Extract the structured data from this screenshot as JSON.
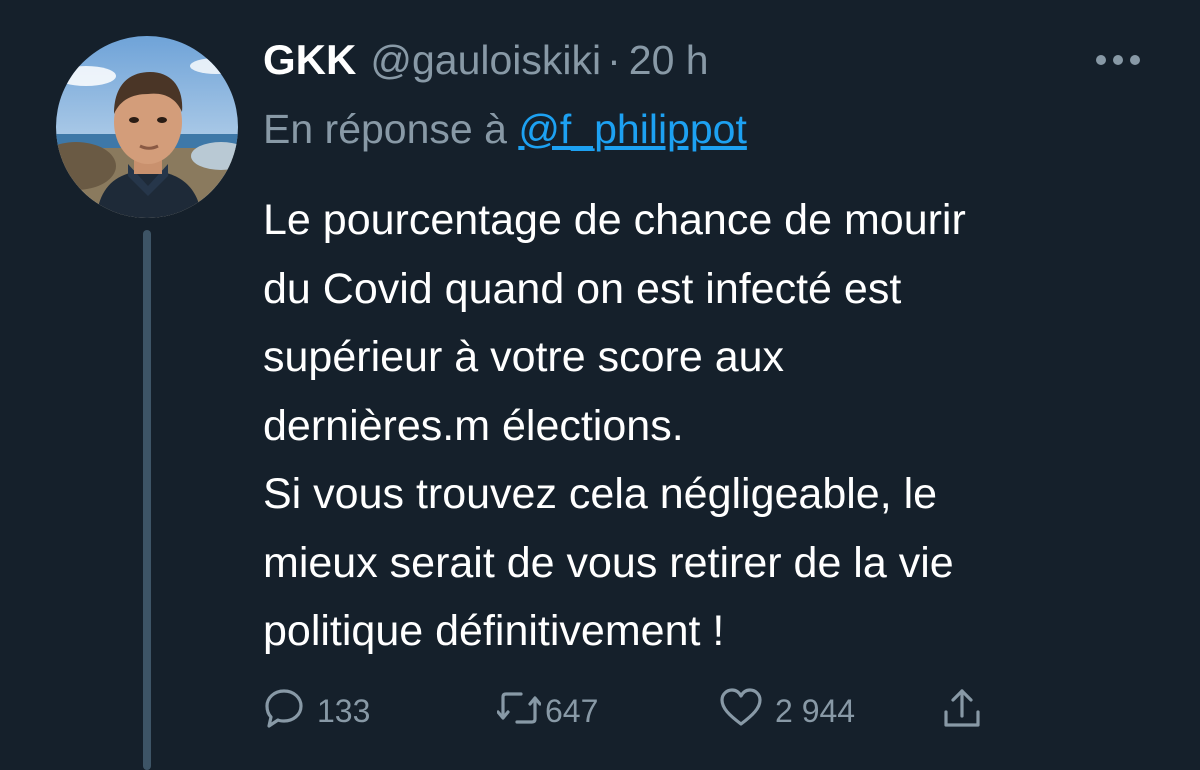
{
  "tweet": {
    "author": {
      "name": "GKK",
      "handle": "@gauloiskiki",
      "separator": "·",
      "time": "20 h"
    },
    "reply_to": {
      "prefix": "En réponse à",
      "mention": "@f_philippot"
    },
    "body_lines": [
      "Le pourcentage de chance de mourir",
      "du Covid quand on est infecté est",
      "supérieur à votre score aux",
      "dernières.m élections.",
      "Si vous trouvez cela négligeable, le",
      "mieux serait de vous retirer de la vie",
      "politique définitivement !"
    ],
    "actions": {
      "replies": "133",
      "retweets": "647",
      "likes": "2 944"
    }
  },
  "icons": {
    "more": "more-horizontal-icon",
    "reply": "speech-bubble-icon",
    "retweet": "retweet-arrows-icon",
    "like": "heart-icon",
    "share": "share-upload-icon"
  },
  "colors": {
    "background": "#15202b",
    "text_primary": "#ffffff",
    "text_secondary": "#8899a6",
    "link": "#1da1f2",
    "thread_line": "#3d5466"
  }
}
